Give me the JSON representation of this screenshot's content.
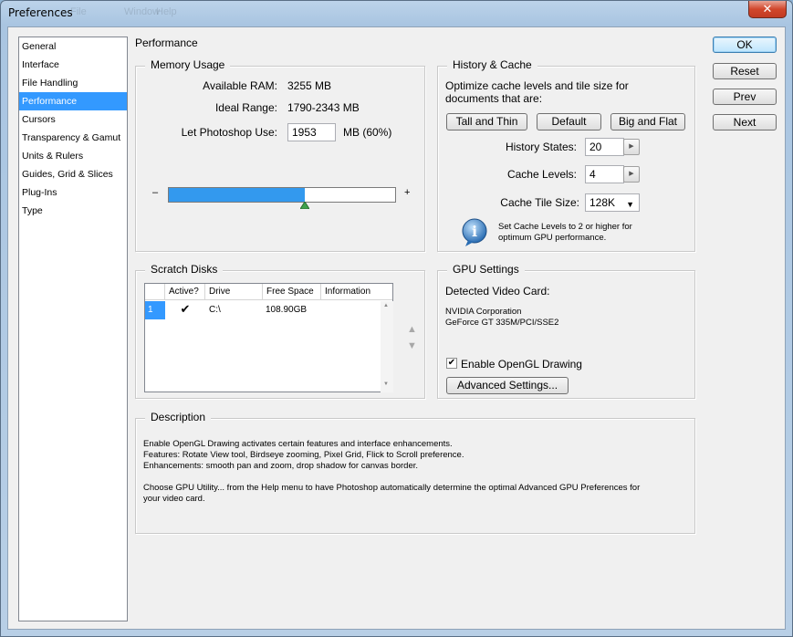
{
  "window": {
    "title": "Preferences",
    "close_glyph": "✕",
    "ghost_menu": [
      "File",
      "Window",
      "Help"
    ]
  },
  "sidebar": {
    "items": [
      {
        "label": "General"
      },
      {
        "label": "Interface"
      },
      {
        "label": "File Handling"
      },
      {
        "label": "Performance",
        "selected": true
      },
      {
        "label": "Cursors"
      },
      {
        "label": "Transparency & Gamut"
      },
      {
        "label": "Units & Rulers"
      },
      {
        "label": "Guides, Grid & Slices"
      },
      {
        "label": "Plug-Ins"
      },
      {
        "label": "Type"
      }
    ]
  },
  "page": {
    "title": "Performance"
  },
  "memory": {
    "group_label": "Memory Usage",
    "available_ram_label": "Available RAM:",
    "available_ram_value": "3255 MB",
    "ideal_range_label": "Ideal Range:",
    "ideal_range_value": "1790-2343 MB",
    "let_use_label": "Let Photoshop Use:",
    "let_use_value": "1953",
    "let_use_suffix": "MB (60%)",
    "slider_min_glyph": "–",
    "slider_max_glyph": "+",
    "slider_fraction": 0.6
  },
  "history_cache": {
    "group_label": "History & Cache",
    "hint": "Optimize cache levels and tile size for documents that are:",
    "buttons": {
      "tall_thin": "Tall and Thin",
      "default": "Default",
      "big_flat": "Big and Flat"
    },
    "history_states_label": "History States:",
    "history_states_value": "20",
    "cache_levels_label": "Cache Levels:",
    "cache_levels_value": "4",
    "tile_size_label": "Cache Tile Size:",
    "tile_size_value": "128K",
    "info_glyph": "i",
    "info_text": "Set Cache Levels to 2 or higher for optimum GPU performance."
  },
  "scratch": {
    "group_label": "Scratch Disks",
    "columns": [
      "Active?",
      "Drive",
      "Free Space",
      "Information"
    ],
    "rows": [
      {
        "index": "1",
        "active": "✔",
        "drive": "C:\\",
        "free_space": "108.90GB",
        "information": ""
      }
    ],
    "up_glyph": "▲",
    "down_glyph": "▼"
  },
  "gpu": {
    "group_label": "GPU Settings",
    "detected_label": "Detected Video Card:",
    "card_vendor": "NVIDIA Corporation",
    "card_model": "GeForce GT 335M/PCI/SSE2",
    "opengl_label": "Enable OpenGL Drawing",
    "opengl_checked": "✔",
    "advanced_button": "Advanced Settings..."
  },
  "description": {
    "group_label": "Description",
    "text": "Enable OpenGL Drawing activates certain features and interface enhancements.\nFeatures: Rotate View tool, Birdseye zooming, Pixel Grid, Flick to Scroll preference.\nEnhancements: smooth pan and zoom, drop shadow for canvas border.\n\nChoose GPU Utility... from the Help menu to have Photoshop automatically determine the optimal Advanced GPU Preferences for\nyour video card."
  },
  "actions": {
    "ok": "OK",
    "reset": "Reset",
    "prev": "Prev",
    "next": "Next"
  },
  "colors": {
    "selection": "#3399ff",
    "slider_fill": "#3399ee",
    "info_icon": "#2a6db3"
  }
}
